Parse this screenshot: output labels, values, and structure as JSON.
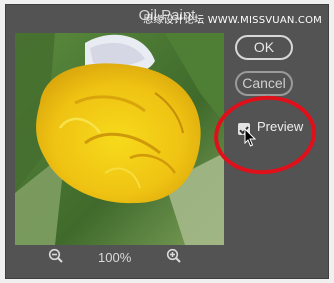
{
  "window": {
    "title": "Oil Paint"
  },
  "watermark": "思缘设计论坛 WWW.MISSVUAN.COM",
  "buttons": {
    "ok": "OK",
    "cancel": "Cancel"
  },
  "preview_option": {
    "label": "Preview",
    "checked": true
  },
  "zoom": {
    "level": "100%",
    "zoom_out_icon": "zoom-out-icon",
    "zoom_in_icon": "zoom-in-icon"
  },
  "colors": {
    "dialog_bg": "#535353",
    "annotation_red": "#e0101b"
  }
}
